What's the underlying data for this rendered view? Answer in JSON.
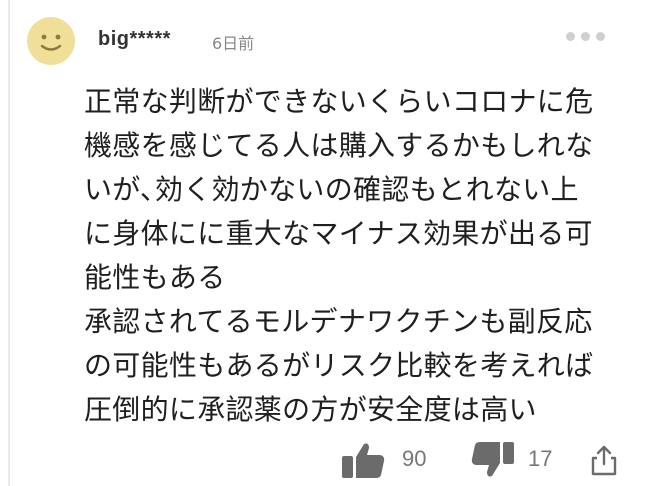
{
  "comment": {
    "username": "big*****",
    "timestamp": "6日前",
    "body_lines": [
      "正常な判断ができないくらいコロナに危",
      "機感を感じてる人は購入するかもしれな",
      "いが､効く効かないの確認もとれない上",
      "に身体にに重大なマイナス効果が出る可",
      "能性もある",
      "承認されてるモルデナワクチンも副反応",
      "の可能性もあるがリスク比較を考えれば",
      "圧倒的に承認薬の方が安全度は高い"
    ]
  },
  "reactions": {
    "like_count": "90",
    "dislike_count": "17"
  },
  "icons": {
    "avatar": "smiley-face-icon",
    "menu": "more-dots-icon",
    "like": "thumbs-up-icon",
    "dislike": "thumbs-down-icon",
    "share": "share-icon"
  },
  "colors": {
    "avatar_bg": "#f0df98",
    "avatar_face": "#8a7a3c",
    "icon_gray": "#6b6b6b",
    "dots_gray": "#cfcfcf"
  }
}
